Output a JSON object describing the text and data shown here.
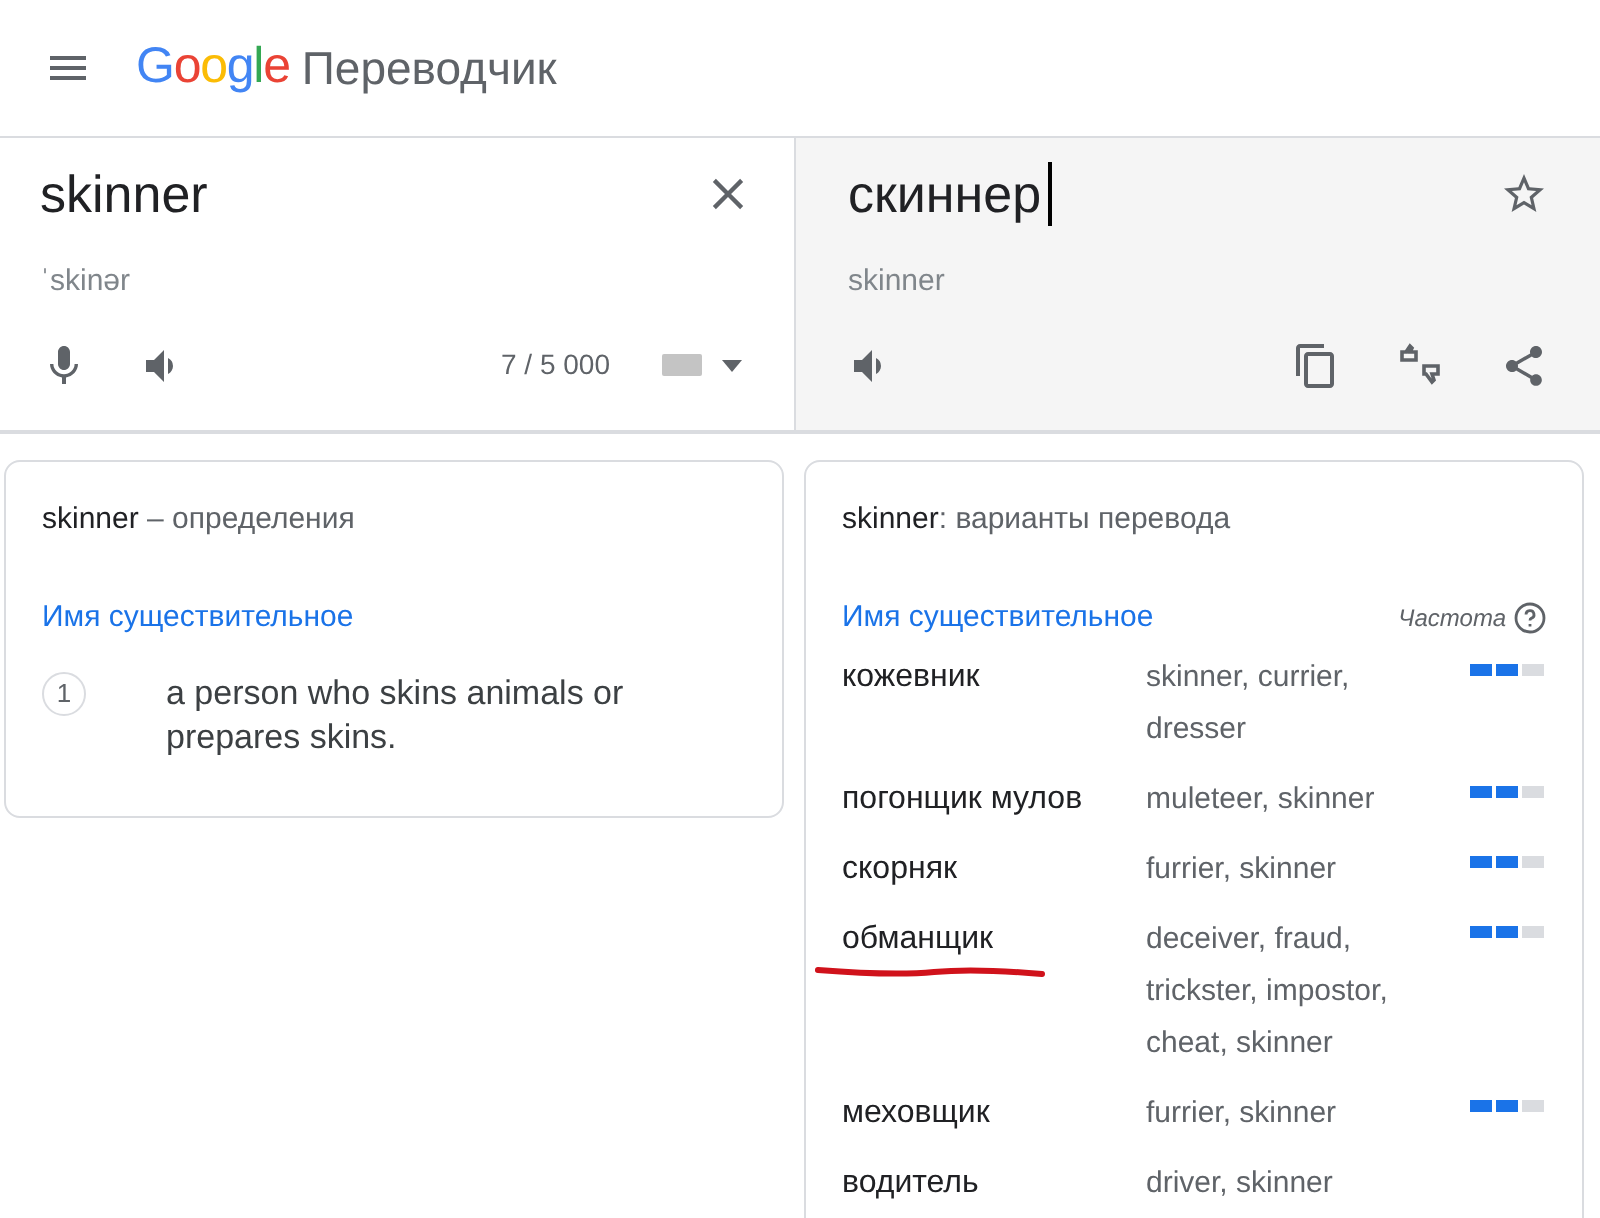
{
  "header": {
    "logo": "Google",
    "title": "Переводчик"
  },
  "source": {
    "text": "skinner",
    "transcription": "ˈskinər",
    "counter": "7 / 5 000"
  },
  "target": {
    "text": "скиннер",
    "transliteration": "skinner"
  },
  "definitions": {
    "word": "skinner",
    "title": " – определения",
    "part_of_speech": "Имя существительное",
    "items": [
      {
        "number": "1",
        "text": "a person who skins animals or prepares skins."
      }
    ]
  },
  "translations": {
    "word": "skinner",
    "title": ": варианты перевода",
    "part_of_speech": "Имя существительное",
    "frequency_label": "Частота",
    "rows": [
      {
        "word": "кожевник",
        "synonyms": "skinner, currier, dresser",
        "level": 0.67,
        "underlined": false
      },
      {
        "word": "погонщик мулов",
        "synonyms": "muleteer, skinner",
        "level": 0.67,
        "underlined": false
      },
      {
        "word": "скорняк",
        "synonyms": "furrier, skinner",
        "level": 0.67,
        "underlined": false
      },
      {
        "word": "обманщик",
        "synonyms": "deceiver, fraud, trickster, impostor, cheat, skinner",
        "level": 0.67,
        "underlined": true
      },
      {
        "word": "меховщик",
        "synonyms": "furrier, skinner",
        "level": 0.67,
        "underlined": false
      },
      {
        "word": "водитель",
        "synonyms": "driver, skinner",
        "underlined": false
      }
    ]
  }
}
